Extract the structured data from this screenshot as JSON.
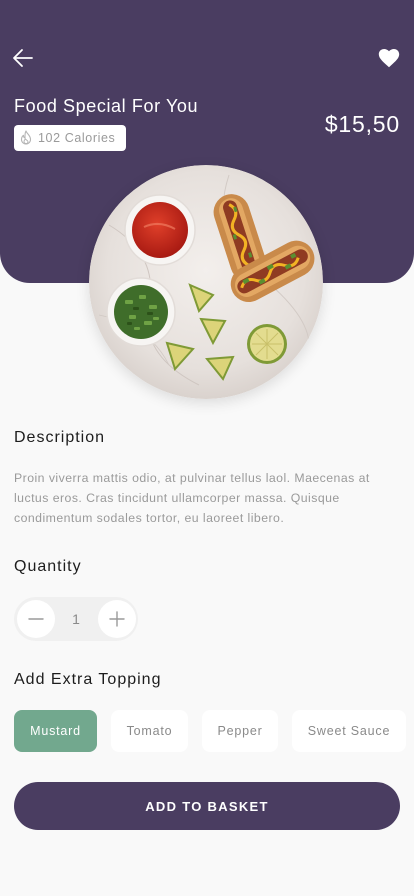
{
  "colors": {
    "primary": "#4a3d61",
    "accent_green": "#72a88e",
    "background": "#f9f9f9",
    "muted_text": "#9a9a9a"
  },
  "header": {
    "back_icon": "arrow-left-icon",
    "favorite_icon": "heart-icon",
    "title": "Food Special For You",
    "calories_icon": "flame-icon",
    "calories": "102 Calories",
    "price": "$15,50"
  },
  "dish_image": "hot dogs with ketchup, chopped green onions and lime wedges on a marble plate",
  "description": {
    "title": "Description",
    "text": "Proin viverra mattis odio, at pulvinar tellus laol. Maecenas at luctus eros. Cras tincidunt ullamcorper massa. Quisque condimentum sodales tortor, eu laoreet libero."
  },
  "quantity": {
    "title": "Quantity",
    "value": "1",
    "minus_icon": "minus-icon",
    "plus_icon": "plus-icon"
  },
  "toppings": {
    "title": "Add Extra Topping",
    "items": [
      {
        "label": "Mustard",
        "selected": true
      },
      {
        "label": "Tomato",
        "selected": false
      },
      {
        "label": "Pepper",
        "selected": false
      },
      {
        "label": "Sweet Sauce",
        "selected": false
      }
    ]
  },
  "cta": {
    "label": "ADD TO BASKET"
  }
}
